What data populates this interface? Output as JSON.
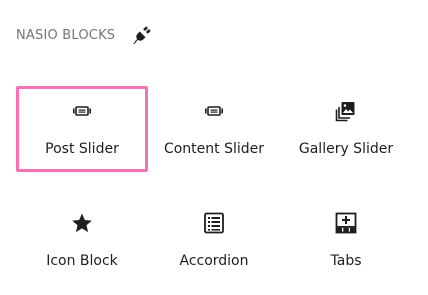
{
  "header": {
    "title": "NASIO BLOCKS",
    "icon": "plug-icon"
  },
  "blocks": [
    {
      "label": "Post Slider",
      "icon": "slider-icon",
      "selected": true
    },
    {
      "label": "Content Slider",
      "icon": "slider-icon",
      "selected": false
    },
    {
      "label": "Gallery Slider",
      "icon": "gallery-icon",
      "selected": false
    },
    {
      "label": "Icon Block",
      "icon": "star-icon",
      "selected": false
    },
    {
      "label": "Accordion",
      "icon": "list-icon",
      "selected": false
    },
    {
      "label": "Tabs",
      "icon": "tabs-icon",
      "selected": false
    }
  ],
  "colors": {
    "selected_border": "#f472b6",
    "header_text": "#757575",
    "label_text": "#1e1e1e"
  }
}
